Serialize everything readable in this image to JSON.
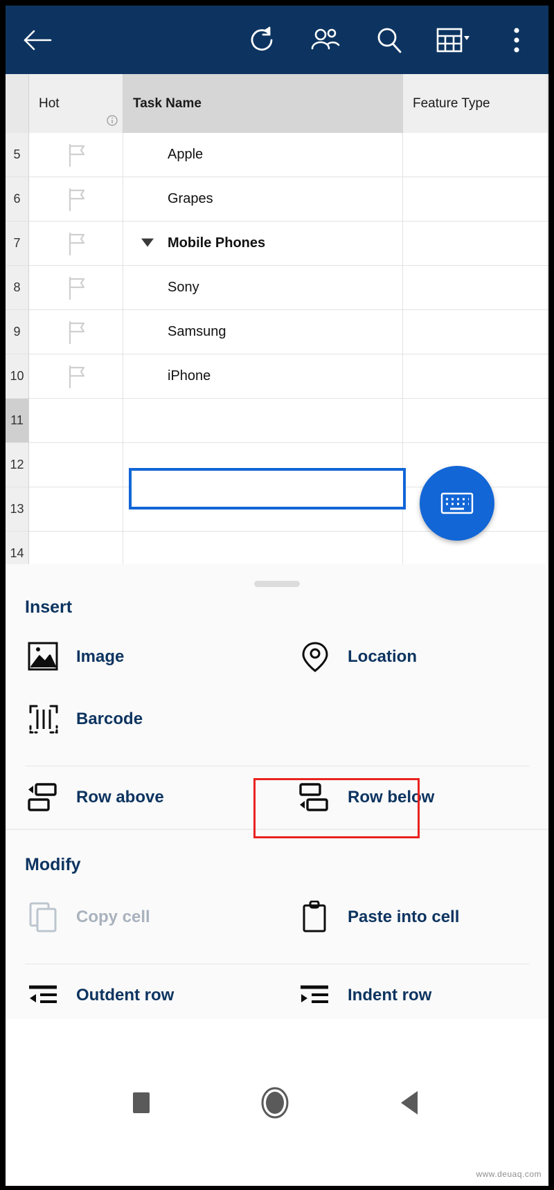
{
  "appbar": {
    "back_label": "Back",
    "icons": [
      {
        "name": "refresh-icon",
        "label": "Refresh"
      },
      {
        "name": "people-icon",
        "label": "Sharing"
      },
      {
        "name": "search-icon",
        "label": "Search"
      },
      {
        "name": "grid-view-icon",
        "label": "View"
      },
      {
        "name": "more-vert-icon",
        "label": "More options"
      }
    ],
    "background_color": "#0d3460"
  },
  "grid": {
    "columns": [
      {
        "key": "hot",
        "label": "Hot",
        "selected": false,
        "has_info_icon": true
      },
      {
        "key": "task_name",
        "label": "Task Name",
        "selected": true,
        "has_info_icon": false
      },
      {
        "key": "feature_type",
        "label": "Feature Type",
        "selected": false,
        "has_info_icon": false
      }
    ],
    "rows": [
      {
        "num": "5",
        "task": "Apple",
        "flag": true,
        "parent": false,
        "active": false
      },
      {
        "num": "6",
        "task": "Grapes",
        "flag": true,
        "parent": false,
        "active": false
      },
      {
        "num": "7",
        "task": "Mobile Phones",
        "flag": true,
        "parent": true,
        "active": false
      },
      {
        "num": "8",
        "task": "Sony",
        "flag": true,
        "parent": false,
        "active": false
      },
      {
        "num": "9",
        "task": "Samsung",
        "flag": true,
        "parent": false,
        "active": false
      },
      {
        "num": "10",
        "task": "iPhone",
        "flag": true,
        "parent": false,
        "active": false
      },
      {
        "num": "11",
        "task": "",
        "flag": false,
        "parent": false,
        "active": true
      },
      {
        "num": "12",
        "task": "",
        "flag": false,
        "parent": false,
        "active": false
      },
      {
        "num": "13",
        "task": "",
        "flag": false,
        "parent": false,
        "active": false
      },
      {
        "num": "14",
        "task": "",
        "flag": false,
        "parent": false,
        "active": false
      }
    ],
    "selected_cell": {
      "row": "11",
      "column": "Task Name",
      "value": "",
      "border_color": "#1266d6"
    }
  },
  "fab": {
    "name": "keyboard-fab",
    "label": "Keyboard",
    "color": "#1266d6"
  },
  "sheet": {
    "sections": [
      {
        "title": "Insert",
        "rows": [
          [
            {
              "icon": "image-icon",
              "label": "Image",
              "disabled": false,
              "highlighted": false
            },
            {
              "icon": "location-icon",
              "label": "Location",
              "disabled": false,
              "highlighted": false
            }
          ],
          [
            {
              "icon": "barcode-icon",
              "label": "Barcode",
              "disabled": false,
              "highlighted": false
            },
            {
              "icon": "",
              "label": "",
              "disabled": false,
              "highlighted": false
            }
          ],
          [
            {
              "icon": "row-above-icon",
              "label": "Row above",
              "disabled": false,
              "highlighted": false
            },
            {
              "icon": "row-below-icon",
              "label": "Row below",
              "disabled": false,
              "highlighted": true
            }
          ]
        ]
      },
      {
        "title": "Modify",
        "rows": [
          [
            {
              "icon": "copy-icon",
              "label": "Copy cell",
              "disabled": true,
              "highlighted": false
            },
            {
              "icon": "clipboard-icon",
              "label": "Paste into cell",
              "disabled": false,
              "highlighted": false
            }
          ],
          [
            {
              "icon": "outdent-icon",
              "label": "Outdent row",
              "disabled": false,
              "highlighted": false
            },
            {
              "icon": "indent-icon",
              "label": "Indent row",
              "disabled": false,
              "highlighted": false
            }
          ]
        ]
      }
    ],
    "highlight_color": "#e8231f"
  },
  "navbar": {
    "buttons": [
      {
        "name": "recents-button",
        "label": "Recent apps"
      },
      {
        "name": "home-button",
        "label": "Home"
      },
      {
        "name": "back-button",
        "label": "Back"
      }
    ]
  },
  "watermark": {
    "text": "www.deuaq.com"
  }
}
